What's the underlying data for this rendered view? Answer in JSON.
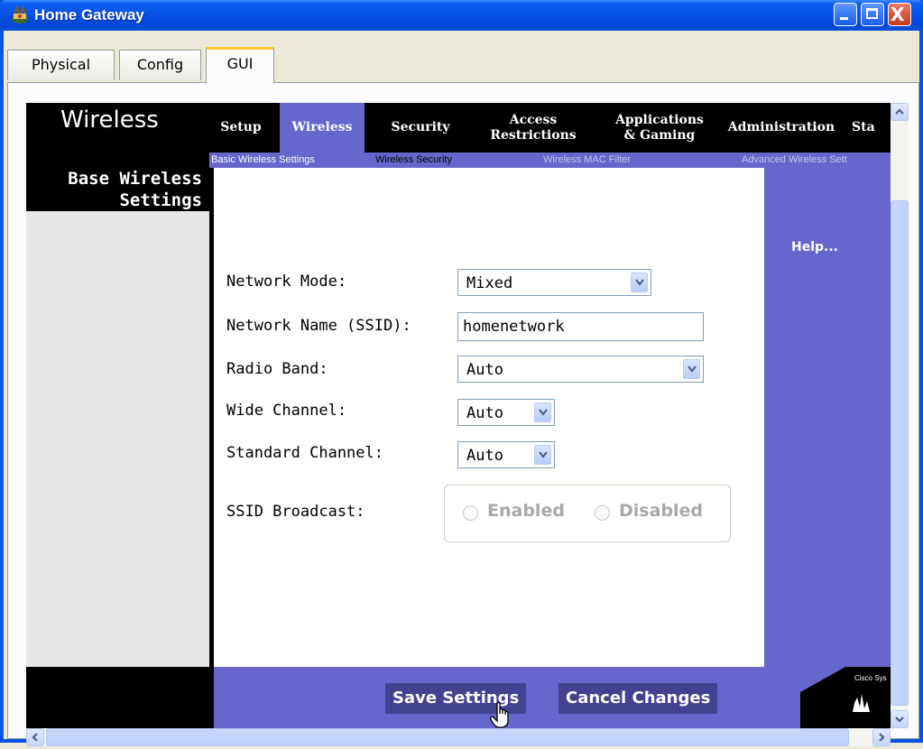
{
  "window": {
    "title": "Home Gateway",
    "minimize_glyph": "",
    "maximize_glyph": "",
    "close_glyph": "X"
  },
  "tabs": [
    {
      "label": "Physical"
    },
    {
      "label": "Config"
    },
    {
      "label": "GUI"
    }
  ],
  "router": {
    "section_title": "Wireless",
    "nav": [
      {
        "label": "Setup"
      },
      {
        "label": "Wireless"
      },
      {
        "label": "Security"
      },
      {
        "label": "Access Restrictions"
      },
      {
        "label": "Applications & Gaming"
      },
      {
        "label": "Administration"
      },
      {
        "label": "Sta"
      }
    ],
    "subnav": [
      {
        "label": "Basic Wireless Settings"
      },
      {
        "label": "Wireless Security"
      },
      {
        "label": "Wireless MAC Filter"
      },
      {
        "label": "Advanced Wireless Sett"
      }
    ],
    "sidebar_title_line1": "Base Wireless",
    "sidebar_title_line2": "Settings",
    "help_link": "Help...",
    "brand_text": "Cisco Sys"
  },
  "form": {
    "network_mode": {
      "label": "Network Mode:",
      "value": "Mixed"
    },
    "ssid": {
      "label": "Network Name (SSID):",
      "value": "homenetwork"
    },
    "radio_band": {
      "label": "Radio Band:",
      "value": "Auto"
    },
    "wide_channel": {
      "label": "Wide Channel:",
      "value": "Auto"
    },
    "standard_channel": {
      "label": "Standard Channel:",
      "value": "Auto"
    },
    "ssid_broadcast": {
      "label": "SSID Broadcast:",
      "enabled_label": "Enabled",
      "disabled_label": "Disabled",
      "enabled_state": "disabled"
    }
  },
  "buttons": {
    "save": "Save Settings",
    "cancel": "Cancel Changes"
  },
  "icons": {
    "title_icon": "router-icon",
    "dropdown": "chevron-down-icon",
    "cursor": "hand-pointer-icon"
  },
  "colors": {
    "accent_purple": "#6666cc",
    "button_dark": "#424290",
    "xp_blue": "#0a53e0"
  }
}
